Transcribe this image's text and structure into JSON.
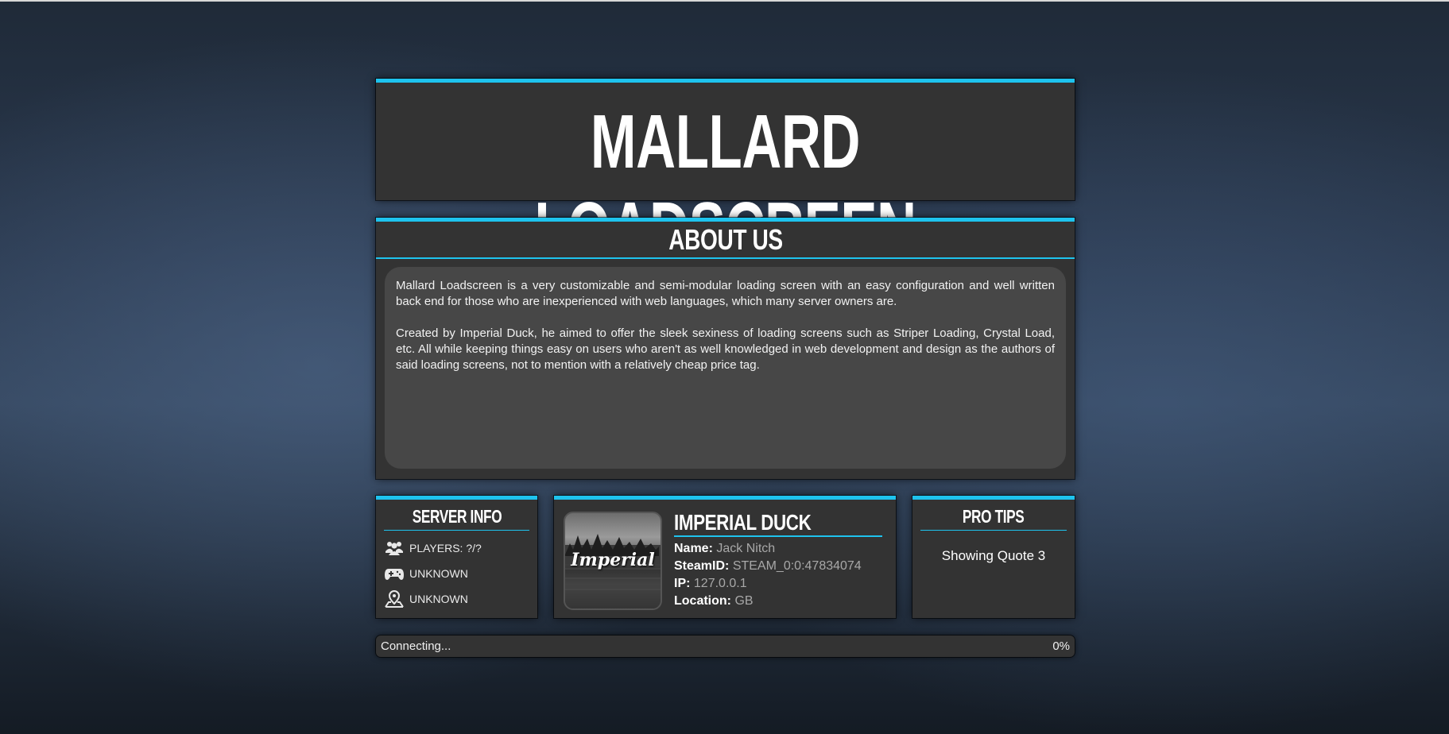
{
  "header": {
    "title": "MALLARD LOADSCREEN"
  },
  "about": {
    "heading": "ABOUT US",
    "paragraphs": [
      "Mallard Loadscreen is a very customizable and semi-modular loading screen with an easy configuration and well written back end for those who are inexperienced with web languages, which many server owners are.",
      "Created by Imperial Duck, he aimed to offer the sleek sexiness of loading screens such as Striper Loading, Crystal Load, etc. All while keeping things easy on users who aren't as well knowledged in web development and design as the authors of said loading screens, not to mention with a relatively cheap price tag."
    ]
  },
  "server_info": {
    "heading": "SERVER INFO",
    "rows": [
      {
        "icon": "users-icon",
        "text": "PLAYERS: ?/?"
      },
      {
        "icon": "gamepad-icon",
        "text": "UNKNOWN"
      },
      {
        "icon": "map-pin-icon",
        "text": "UNKNOWN"
      }
    ]
  },
  "profile": {
    "avatar_text": "Imperial",
    "name": "IMPERIAL DUCK",
    "fields": [
      {
        "label": "Name:",
        "value": "Jack Nitch"
      },
      {
        "label": "SteamID:",
        "value": "STEAM_0:0:47834074"
      },
      {
        "label": "IP:",
        "value": "127.0.0.1"
      },
      {
        "label": "Location:",
        "value": "GB"
      }
    ]
  },
  "pro_tips": {
    "heading": "PRO TIPS",
    "text": "Showing Quote 3"
  },
  "progress": {
    "status": "Connecting...",
    "percent_label": "0%",
    "percent": 0
  },
  "colors": {
    "accent": "#1ec3ee",
    "panel": "#333333",
    "content_box": "#474747"
  }
}
